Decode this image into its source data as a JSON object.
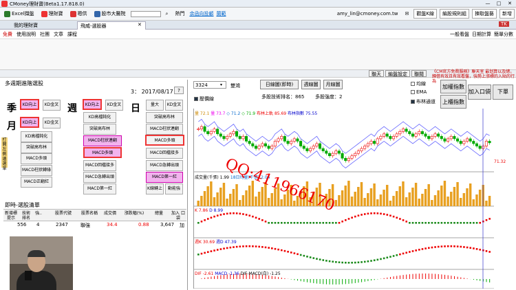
{
  "window": {
    "title": "CMoney理財寶(Beta1.17.818.0)"
  },
  "toolbar": {
    "items": [
      "Excel擷盤",
      "理財寶",
      "嗯供",
      "股市大醫院"
    ],
    "search_value": "",
    "hot_label": "熱門",
    "hot_link": "余函向投顧",
    "hot_link2": "蘭範",
    "user": "amy_lin@cmoney.com.tw",
    "right_buttons": [
      "觀盤K線",
      "編股規則組",
      "揀取盤藝"
    ],
    "new_btn": "新增"
  },
  "tabs": {
    "items": [
      "我的理財寶",
      "飛威-選股器"
    ]
  },
  "subbar": {
    "items": [
      "免費",
      "使用說明",
      "社團",
      "文章",
      "課程"
    ],
    "right": [
      "一般看盤",
      "日期計算",
      "簡單分數"
    ]
  },
  "bar2": {
    "buttons": [
      "聯天",
      "編盤設定",
      "聯閱"
    ],
    "notice": "《CM官方免費服務》聯天室 最划算以及總，歸借有效且有效看盤，強勢上漲標的入貼的行為"
  },
  "left": {
    "title": "多週期進階選股",
    "date_label": "3：  2017/08/17",
    "help": "?",
    "periods": {
      "season": "季",
      "month": "月",
      "week": "週",
      "day": "日"
    },
    "season_btns": [
      "KD向上",
      "KD金叉"
    ],
    "month_btns": [
      "KD向上",
      "KD金叉",
      "KD高檔鈍化",
      "突破高布林",
      "MACD多頭",
      "MACD柱狀轉綠",
      "MACD正翻紅"
    ],
    "week_btns": [
      "KD向上",
      "KD金叉",
      "KD高檔鈍化",
      "突破高布林",
      "MACD柱狀連翻",
      "MACD多頭",
      "MACD回檔接多",
      "MACD急轉出頭",
      "MACD第一紅"
    ],
    "day_btns": [
      "量大",
      "KD金叉",
      "突破高布林",
      "MACD柱狀連翻",
      "MACD多頭",
      "MACD回檔接多",
      "MACD急轉出頭",
      "MACD第一紅",
      "K線轉上",
      "動能強"
    ],
    "side_strip": "打開左側邊選單",
    "table_title": "即時-選股清單",
    "table_headers": [
      "新增標\n提示",
      "技術\n排名",
      "強..",
      "股票代號",
      "股票名稱",
      "成交價",
      "漲跌幅(%)",
      "總量",
      "加入\n口袋"
    ],
    "table_row": [
      "556",
      "4",
      "2347",
      "聯強",
      "34.4",
      "0.88",
      "3,647",
      "加"
    ]
  },
  "right": {
    "stock_input": "3324",
    "stock_name": "雙鴻",
    "period_buttons": [
      "日線圖(即時)",
      "週線圖",
      "月線圖"
    ],
    "rank_text": "多股技術排名：865",
    "strength_text": "多股強度：2",
    "check_options": [
      {
        "label": "均線",
        "on": false
      },
      {
        "label": "EMA",
        "on": false
      },
      {
        "label": "布林通道",
        "on": true
      },
      {
        "label": "壓價線",
        "on": true
      }
    ],
    "action_buttons": [
      "加權指數",
      "上櫃指數",
      "加入口袋",
      "下單"
    ]
  },
  "chart": {
    "ma_header": [
      "量 72.1",
      "量 73.7",
      "◇ 71.2",
      "◇ 71.9",
      "布林上軌 85.69",
      "布林指數 75.55"
    ],
    "vol_header": [
      "成交量(千張) 1.99",
      "18日均量(千張) 2.04"
    ],
    "k_header": [
      "K 7.86",
      "D 8.99"
    ],
    "k2_header": [
      "週K 30.69",
      "週D 47.39"
    ],
    "macd_header": [
      "DIF -2.61",
      "MACD -1.36",
      "DIF-MACD(白) -1.25"
    ],
    "price_last": "71.32",
    "watermark": "QQ:411966170"
  },
  "chart_data": {
    "type": "candlestick",
    "close": [
      77,
      78,
      76,
      75,
      76,
      77,
      75,
      74,
      73,
      74,
      75,
      76,
      74,
      73,
      74,
      72,
      71,
      70,
      69,
      70,
      71,
      70,
      69,
      70,
      72,
      73,
      74,
      72,
      71,
      72,
      73,
      72,
      70,
      69,
      68,
      69,
      70,
      71,
      69,
      68,
      67,
      66,
      67,
      68,
      67,
      65,
      64,
      65,
      66,
      67,
      68,
      69,
      70,
      71,
      72,
      71,
      73,
      74,
      75,
      74,
      73,
      74,
      75,
      76,
      77,
      76,
      75,
      74,
      75,
      76,
      75,
      74,
      73,
      74,
      75,
      74,
      73,
      72,
      73,
      74,
      73,
      72,
      71,
      72,
      73,
      72,
      71,
      70,
      69,
      70,
      72,
      71.32
    ],
    "colors": {
      "up": "#e00",
      "down": "#0a0",
      "bg": "#fff"
    }
  }
}
